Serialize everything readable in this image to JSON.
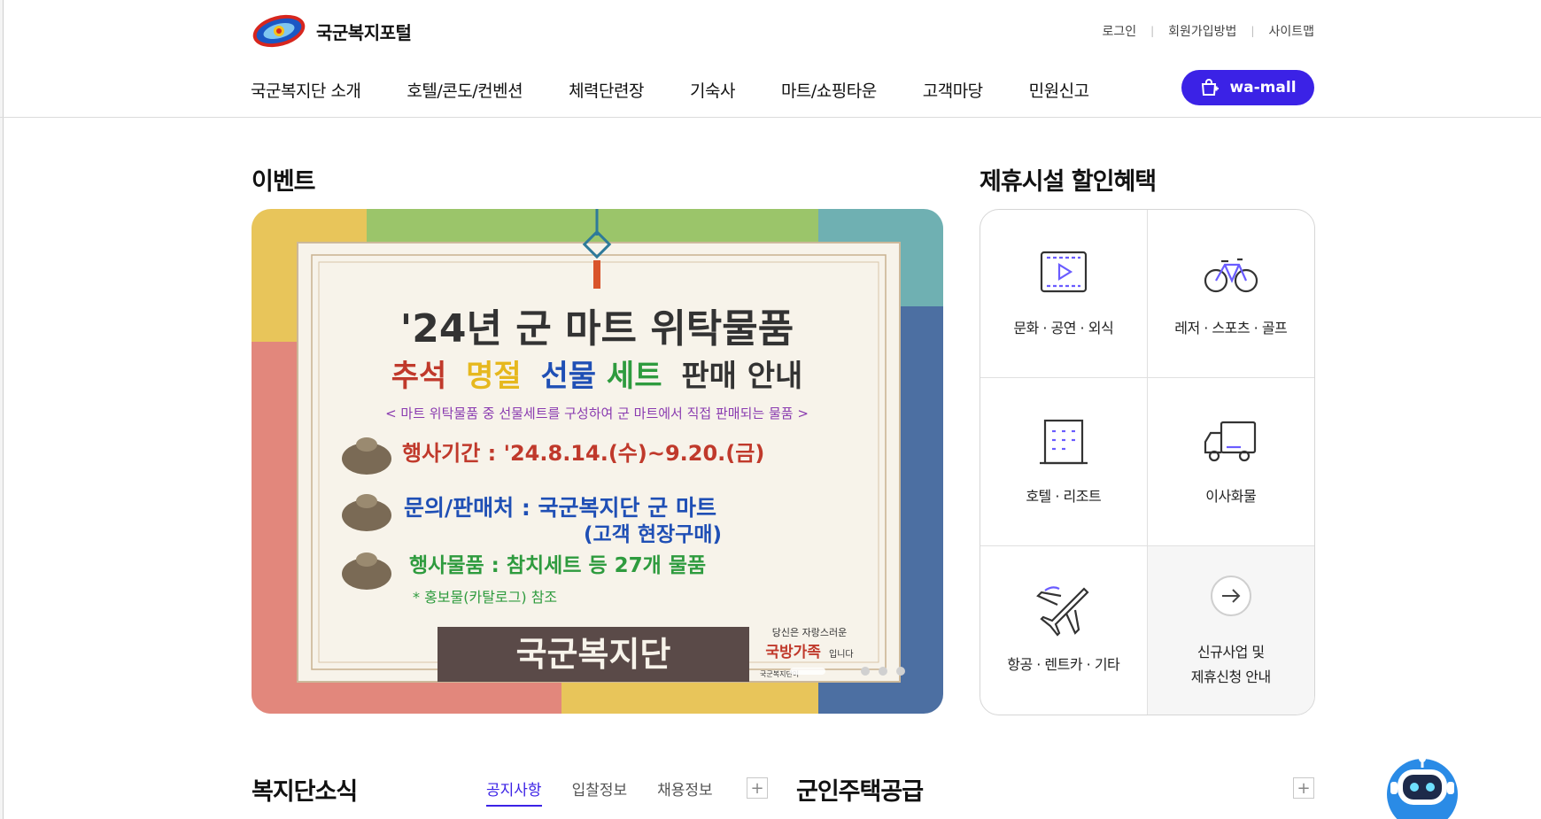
{
  "header": {
    "site_title": "국군복지포털",
    "util_links": [
      "로그인",
      "회원가입방법",
      "사이트맵"
    ],
    "nav": [
      "국군복지단 소개",
      "호텔/콘도/컨벤션",
      "체력단련장",
      "기숙사",
      "마트/쇼핑타운",
      "고객마당",
      "민원신고"
    ],
    "wamall_label": "wa-mall"
  },
  "event": {
    "section_title": "이벤트",
    "banner": {
      "headline1": "'24년 군 마트 위탁물품",
      "headline2_parts": [
        "추석",
        "명절",
        "선물",
        "세트",
        "판매 안내"
      ],
      "subline": "< 마트 위탁물품 중 선물세트를 구성하여 군 마트에서  직접 판매되는 물품 >",
      "line_period": "행사기간 : '24.8.14.(수)~9.20.(금)",
      "line_inquiry1": "문의/판매처 : 국군복지단 군 마트",
      "line_inquiry2": "(고객 현장구매)",
      "line_items": "행사물품 : 참치세트 등 27개 물품",
      "line_note": "* 홍보물(카탈로그) 참조",
      "footer_org": "국군복지단",
      "footer_slogan1": "당신은 자랑스러운",
      "footer_slogan2": "국방가족",
      "footer_slogan3": "입니다",
      "footer_small": "국군복지단이"
    },
    "slide_count": 3,
    "active_slide": 0
  },
  "partners": {
    "section_title": "제휴시설 할인혜택",
    "items": [
      {
        "label": "문화 · 공연 · 외식",
        "icon": "video-play-icon"
      },
      {
        "label": "레저 · 스포츠 · 골프",
        "icon": "bicycle-icon"
      },
      {
        "label": "호텔 · 리조트",
        "icon": "building-icon"
      },
      {
        "label": "이사화물",
        "icon": "truck-icon"
      },
      {
        "label": "항공 · 렌트카 · 기타",
        "icon": "airplane-icon"
      },
      {
        "label": "신규사업 및\n제휴신청 안내",
        "icon": "arrow-right-icon"
      }
    ]
  },
  "news": {
    "section_title": "복지단소식",
    "tabs": [
      "공지사항",
      "입찰정보",
      "채용정보"
    ],
    "active_tab": 0,
    "more": "+"
  },
  "housing": {
    "section_title": "군인주택공급",
    "more": "+"
  },
  "colors": {
    "accent": "#3b22e6",
    "banner_red": "#c0392b",
    "banner_blue": "#1f4fb5",
    "banner_green": "#2e9b3e",
    "banner_yellow": "#e6b81e"
  }
}
